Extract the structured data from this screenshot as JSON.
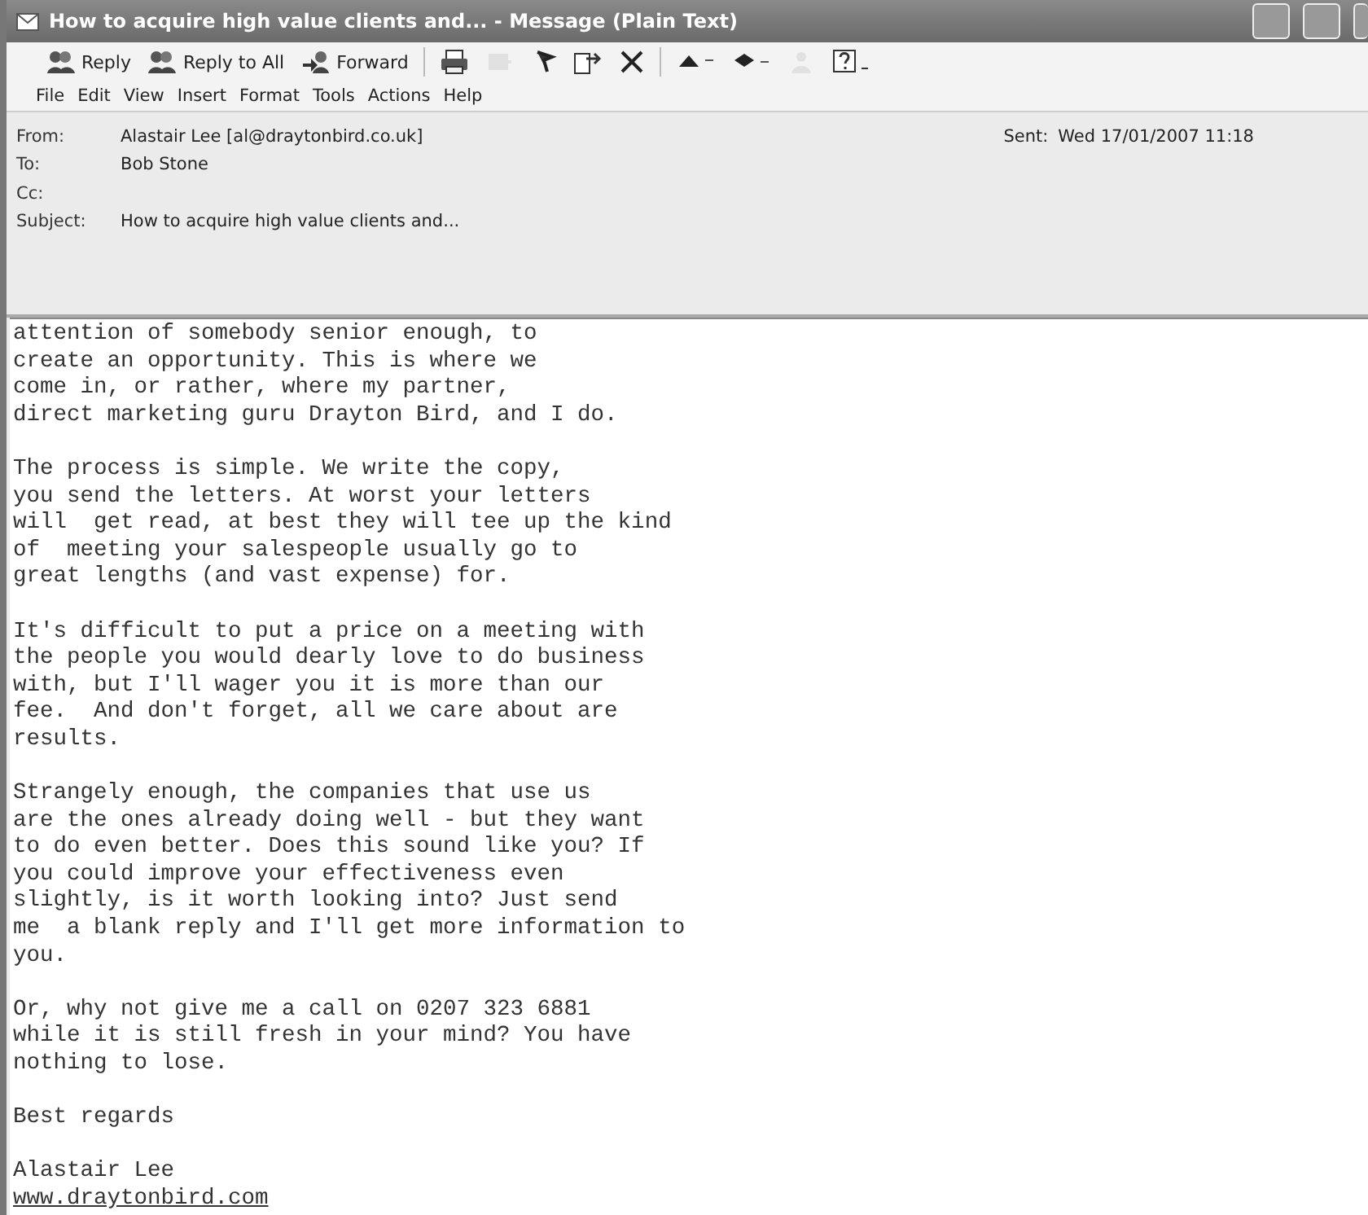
{
  "window": {
    "title": "How to acquire high value clients and... - Message (Plain Text)"
  },
  "toolbar": [
    {
      "kind": "reply",
      "label": "Reply",
      "disabled": false
    },
    {
      "kind": "reply-all",
      "label": "Reply to All",
      "disabled": false
    },
    {
      "kind": "forward",
      "label": "Forward",
      "disabled": false
    },
    {
      "kind": "print",
      "disabled": false
    },
    {
      "kind": "move",
      "disabled": true
    },
    {
      "kind": "flag",
      "disabled": false
    },
    {
      "kind": "copy",
      "disabled": false
    },
    {
      "kind": "delete",
      "disabled": false
    },
    {
      "kind": "previous",
      "disabled": false
    },
    {
      "kind": "next",
      "disabled": false
    },
    {
      "kind": "address-book",
      "disabled": true
    },
    {
      "kind": "help",
      "disabled": false
    }
  ],
  "menu": [
    "File",
    "Edit",
    "View",
    "Insert",
    "Format",
    "Tools",
    "Actions",
    "Help"
  ],
  "header": {
    "from_label": "From:",
    "from": "Alastair Lee [al@draytonbird.co.uk]",
    "sent_label": "Sent:",
    "sent": "Wed 17/01/2007 11:18",
    "to_label": "To:",
    "to": "Bob Stone",
    "cc_label": "Cc:",
    "subject_label": "Subject:",
    "subject": "How to acquire high value clients and..."
  },
  "body": [
    [
      "attention of somebody senior enough, to",
      "create an opportunity. This is where we",
      "come in, or rather, where my partner,",
      "direct marketing guru Drayton Bird, and I do."
    ],
    [
      "The process is simple. We write the copy,",
      "you send the letters. At worst your letters",
      "will  get read, at best they will tee up the kind",
      "of  meeting your salespeople usually go to",
      "great lengths (and vast expense) for."
    ],
    [
      "It's difficult to put a price on a meeting with",
      "the people you would dearly love to do business",
      "with, but I'll wager you it is more than our",
      "fee.  And don't forget, all we care about are",
      "results."
    ],
    [
      "Strangely enough, the companies that use us",
      "are the ones already doing well - but they want",
      "to do even better. Does this sound like you? If",
      "you could improve your effectiveness even",
      "slightly, is it worth looking into? Just send",
      "me  a blank reply and I'll get more information to",
      "you."
    ],
    [
      "Or, why not give me a call on 0207 323 6881",
      "while it is still fresh in your mind? You have",
      "nothing to lose."
    ],
    [
      "Best regards"
    ],
    [
      "Alastair Lee"
    ]
  ],
  "link": "www.draytonbird.com"
}
